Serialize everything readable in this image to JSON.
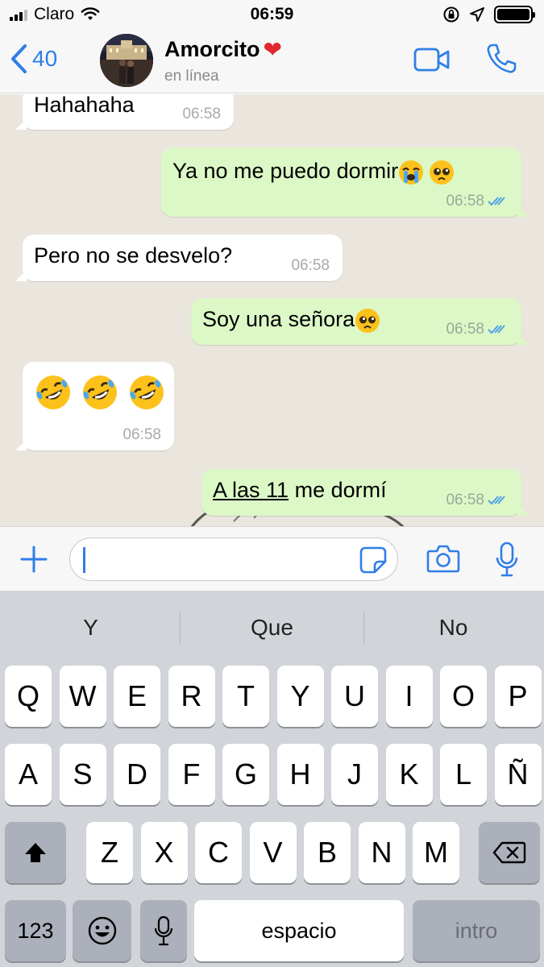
{
  "status_bar": {
    "carrier": "Claro",
    "time": "06:59",
    "battery_level": 1.0
  },
  "header": {
    "back_count": "40",
    "contact_name": "Amorcito",
    "contact_status": "en línea",
    "accent_color": "#2f7ee8"
  },
  "messages": [
    {
      "direction": "in",
      "text": "Hahahaha",
      "time": "06:58"
    },
    {
      "direction": "out",
      "text": "Ya no me puedo dormir",
      "emojis": [
        "loudly-crying-face",
        "pleading-face"
      ],
      "time": "06:58",
      "read": true
    },
    {
      "direction": "in",
      "text": "Pero no se desvelo?",
      "time": "06:58"
    },
    {
      "direction": "out",
      "text": "Soy una señora",
      "emojis": [
        "pleading-face"
      ],
      "time": "06:58",
      "read": true
    },
    {
      "direction": "in",
      "text": "",
      "emojis": [
        "rolling-laughing-face",
        "rolling-laughing-face",
        "rolling-laughing-face"
      ],
      "time": "06:58"
    },
    {
      "direction": "out",
      "text_underlined": "A las 11",
      "text_rest": " me dormí",
      "time": "06:58",
      "read": true
    }
  ],
  "input": {
    "value": ""
  },
  "keyboard": {
    "suggestions": [
      "Y",
      "Que",
      "No"
    ],
    "row1": [
      "Q",
      "W",
      "E",
      "R",
      "T",
      "Y",
      "U",
      "I",
      "O",
      "P"
    ],
    "row2": [
      "A",
      "S",
      "D",
      "F",
      "G",
      "H",
      "J",
      "K",
      "L",
      "Ñ"
    ],
    "row3": [
      "Z",
      "X",
      "C",
      "V",
      "B",
      "N",
      "M"
    ],
    "numbers_label": "123",
    "space_label": "espacio",
    "return_label": "intro"
  }
}
